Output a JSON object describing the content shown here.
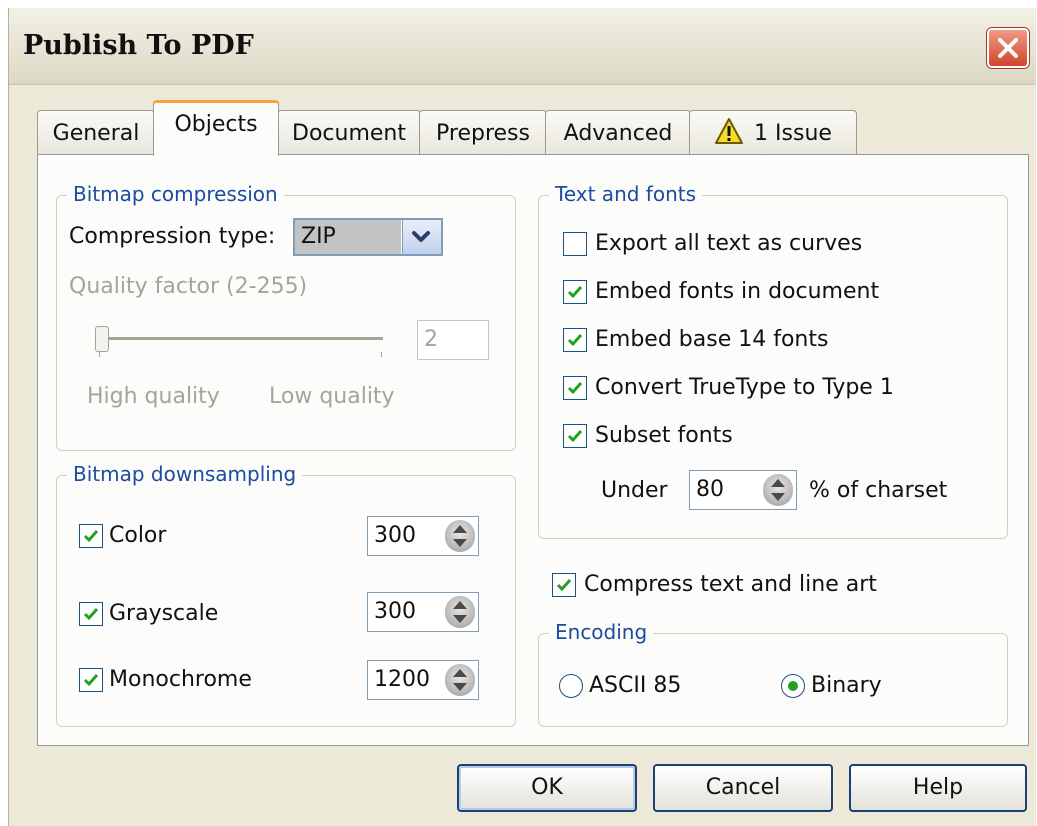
{
  "window": {
    "title": "Publish To PDF"
  },
  "tabs": [
    {
      "label": "General"
    },
    {
      "label": "Objects",
      "active": true
    },
    {
      "label": "Document"
    },
    {
      "label": "Prepress"
    },
    {
      "label": "Advanced"
    },
    {
      "label": "1 Issue",
      "icon": "warning-icon"
    }
  ],
  "bitmap_compression": {
    "legend": "Bitmap compression",
    "compression_type_label": "Compression type:",
    "compression_type_value": "ZIP",
    "quality_label": "Quality factor (2-255)",
    "quality_value": "2",
    "slider_level": 0,
    "high_label": "High quality",
    "low_label": "Low quality"
  },
  "bitmap_downsampling": {
    "legend": "Bitmap downsampling",
    "items": [
      {
        "label": "Color",
        "checked": true,
        "value": "300"
      },
      {
        "label": "Grayscale",
        "checked": true,
        "value": "300"
      },
      {
        "label": "Monochrome",
        "checked": true,
        "value": "1200"
      }
    ]
  },
  "text_and_fonts": {
    "legend": "Text and fonts",
    "options": [
      {
        "label": "Export all text as curves",
        "checked": false
      },
      {
        "label": "Embed fonts in document",
        "checked": true
      },
      {
        "label": "Embed base 14 fonts",
        "checked": true
      },
      {
        "label": "Convert TrueType to Type 1",
        "checked": true
      },
      {
        "label": "Subset fonts",
        "checked": true
      }
    ],
    "under_label": "Under",
    "under_value": "80",
    "charset_label": "% of charset"
  },
  "compress": {
    "label": "Compress text and line art",
    "checked": true
  },
  "encoding": {
    "legend": "Encoding",
    "options": [
      {
        "label": "ASCII 85",
        "selected": false
      },
      {
        "label": "Binary",
        "selected": true
      }
    ]
  },
  "buttons": {
    "ok": "OK",
    "cancel": "Cancel",
    "help": "Help"
  },
  "colors": {
    "accent": "#1c4ba0",
    "check": "#21a121",
    "tab_highlight": "#f5a53a",
    "close": "#d1442b"
  }
}
